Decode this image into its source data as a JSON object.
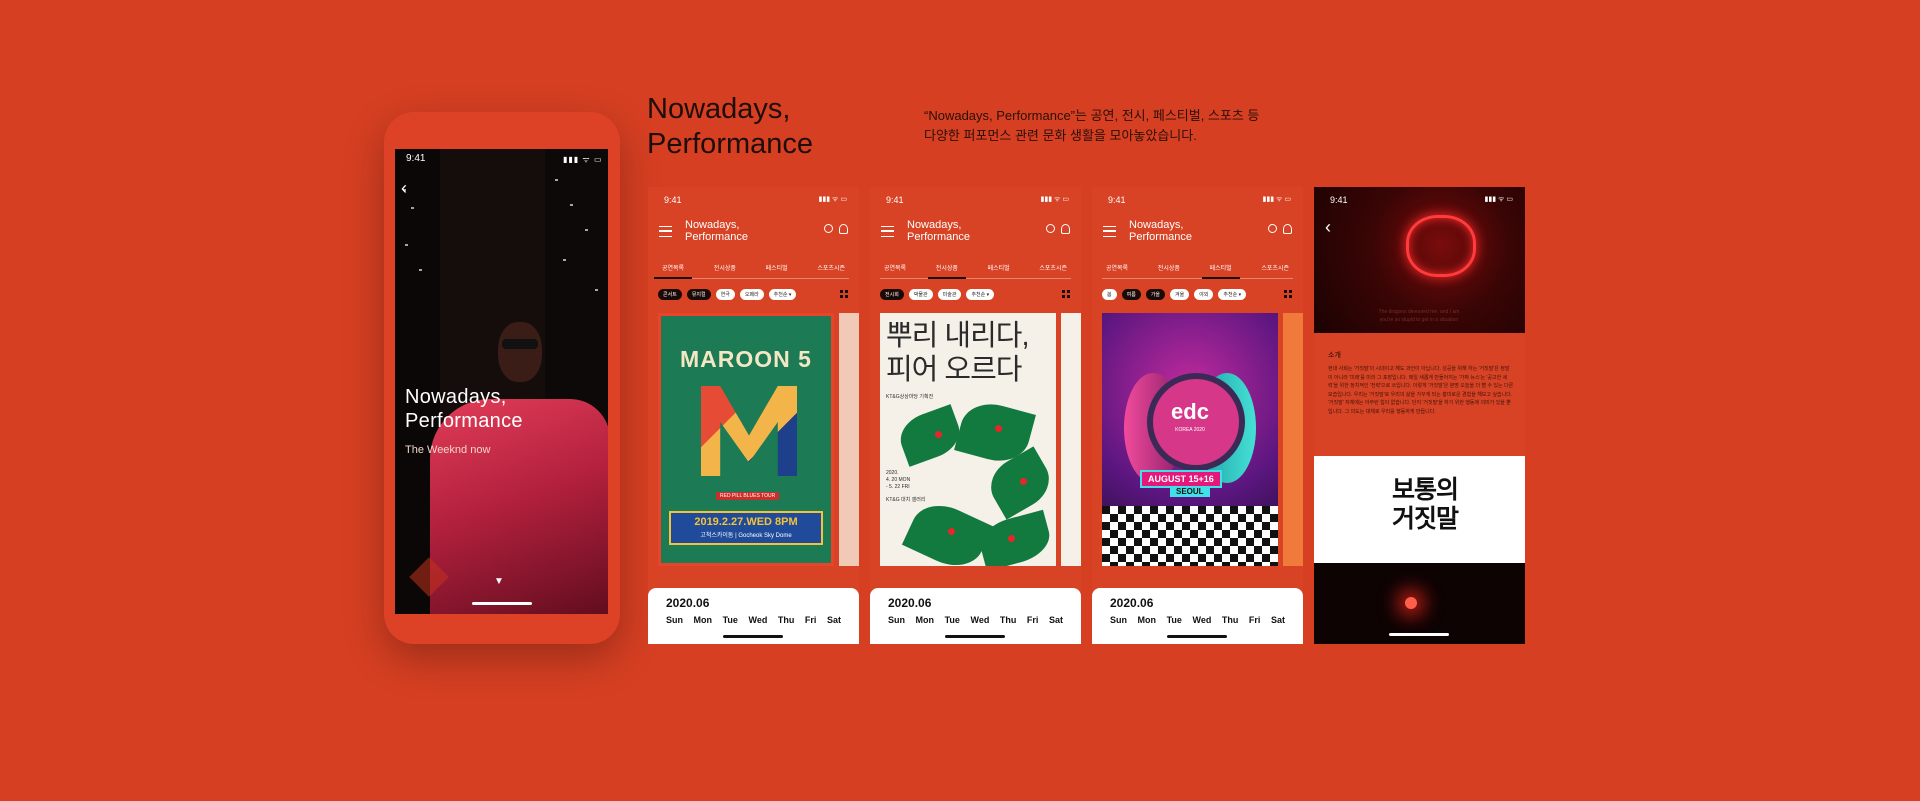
{
  "hero": {
    "time": "9:41",
    "title_line1": "Nowadays,",
    "title_line2": "Performance",
    "subtitle": "The Weeknd now",
    "back_glyph": "‹",
    "scroll_glyph": "▼"
  },
  "header": {
    "title_line1": "Nowadays,",
    "title_line2": "Performance",
    "description_line1": "“Nowadays, Performance”는 공연, 전시, 페스티벌, 스포츠 등",
    "description_line2": "다양한 퍼포먼스 관련 문화 생활을 모아놓았습니다."
  },
  "status": {
    "time": "9:41",
    "icons": "▮▮▮ ᯤ ▭"
  },
  "app": {
    "title_line1": "Nowadays,",
    "title_line2": "Performance"
  },
  "tabs": [
    "공연목록",
    "전시상품",
    "페스티벌",
    "스포츠시즌"
  ],
  "screens": [
    {
      "active_tab": 0,
      "chips": [
        "콘서트",
        "뮤지컬",
        "연극",
        "오페라",
        "추천순 ▾"
      ],
      "dark_chips": [
        0,
        1
      ],
      "poster": {
        "logo": "MAROON 5",
        "tour": "RED PILL BLUES TOUR",
        "date": "2019.2.27.WED 8PM",
        "venue": "고척스카이돔 | Gocheok Sky Dome"
      }
    },
    {
      "active_tab": 1,
      "chips": [
        "전시회",
        "박물관",
        "미술관",
        "추천순 ▾"
      ],
      "dark_chips": [
        0
      ],
      "poster": {
        "title_line1": "뿌리 내리다,",
        "title_line2": "피어 오르다",
        "small": "KT&G상상마당 기획전",
        "date1": "2020.",
        "date2": "4. 20 MON",
        "date3": "- 5. 22 FRI",
        "venue": "KT&G 대치 갤러리"
      }
    },
    {
      "active_tab": 2,
      "chips": [
        "봄",
        "여름",
        "가을",
        "겨울",
        "야외",
        "추천순 ▾"
      ],
      "dark_chips": [
        1,
        2
      ],
      "poster": {
        "logo": "edc",
        "sublogo": "KOREA 2020",
        "date": "AUGUST 15+16",
        "city": "SEOUL"
      }
    }
  ],
  "calendar": {
    "month": "2020.06",
    "days": [
      "Sun",
      "Mon",
      "Tue",
      "Wed",
      "Thu",
      "Fri",
      "Sat"
    ]
  },
  "detail": {
    "time": "9:41",
    "back_glyph": "‹",
    "quote_line1": "The dragons devoured me, and I am",
    "quote_line2": "you're so stupid to get in a situation",
    "section_title": "소개",
    "body": "현대 사회는 '거짓말'의 시대이고 해도 과언이 아닙니다. 성공을 위해 하는 '거짓말'은 정말이 아니라 '미래'를 미리 그 포장입니다. 매일 새롭게 만들어지는 '가짜 뉴스'는 '공고한 세력'을 위한 정치적인 '전략'으로 쓰입니다. 이렇게 '거짓말'은 분명 오늘을 더 빨 수 있는 다른 모습입니다. 우리는 '거짓말'로 우리의 삶을 가꾸게 되는 흥미로운 경험을 해보고 싶습니다. '거짓말' 자체에는 아무런 힘이 없습니다. 단지 '거짓말'을 하기 위한 행동에 의미가 있을 뿐입니다. 그 의도는 대체로 우리를 행동하게 만듭니다.",
    "card_title_line1": "보통의",
    "card_title_line2": "거짓말"
  },
  "colors": {
    "background": "#d63f22",
    "accent_dark": "#1a0a06",
    "white": "#ffffff"
  }
}
